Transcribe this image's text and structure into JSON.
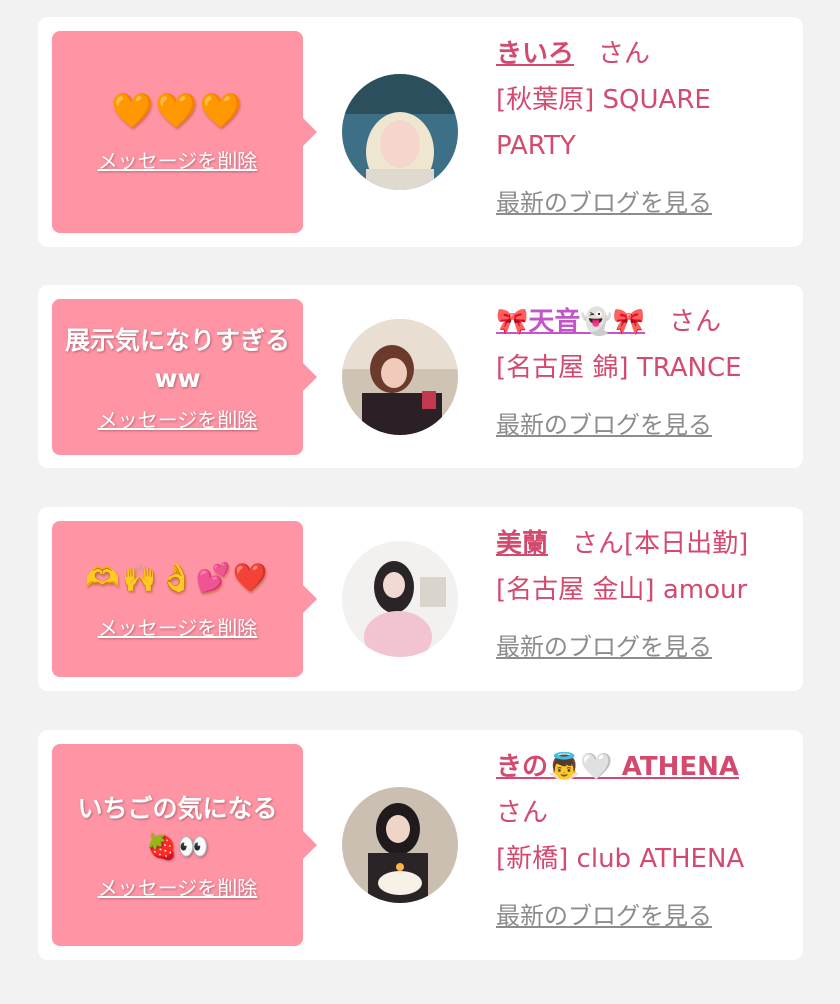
{
  "cards": [
    {
      "message_icons": "🧡🧡🧡",
      "delete_label": "メッセージを削除",
      "name": "きいろ",
      "suffix": "さん",
      "shop": "[秋葉原] SQUARE PARTY",
      "blog_label": "最新のブログを見る"
    },
    {
      "message": "展示気になりすぎるww",
      "delete_label": "メッセージを削除",
      "name": "🎀天音👻🎀",
      "suffix": "さん",
      "shop": "[名古屋 錦] TRANCE",
      "blog_label": "最新のブログを見る"
    },
    {
      "message_icons": "🫶🙌👌💕❤️",
      "delete_label": "メッセージを削除",
      "name": "美蘭",
      "suffix": "さん[本日出勤]",
      "shop": "[名古屋 金山] amour",
      "blog_label": "最新のブログを見る"
    },
    {
      "message": "いちごの気になる🍓👀",
      "delete_label": "メッセージを削除",
      "name": "きの👼🤍 ATHENA",
      "suffix": "さん",
      "shop": "[新橋] club ATHENA",
      "blog_label": "最新のブログを見る"
    }
  ],
  "colors": {
    "page_bg": "#f2f2f2",
    "card_bg": "#ffffff",
    "bubble_bg": "#fe94a4",
    "accent_text": "#d44a6e",
    "muted_link": "#8c8c8c"
  },
  "icons": [
    "avatar-photo"
  ]
}
